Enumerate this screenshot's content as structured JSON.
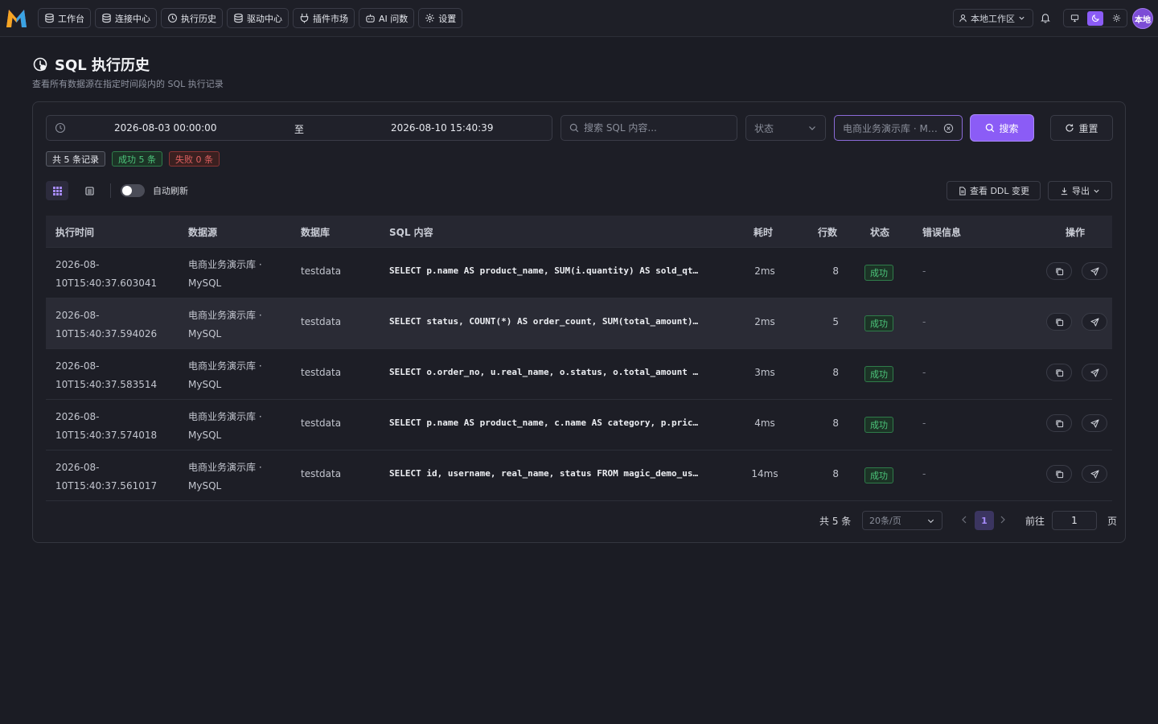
{
  "nav": {
    "items": [
      {
        "label": "工作台",
        "icon": "database-icon"
      },
      {
        "label": "连接中心",
        "icon": "database-icon"
      },
      {
        "label": "执行历史",
        "icon": "history-icon"
      },
      {
        "label": "驱动中心",
        "icon": "database-icon"
      },
      {
        "label": "插件市场",
        "icon": "plug-icon"
      },
      {
        "label": "AI 问数",
        "icon": "robot-icon"
      },
      {
        "label": "设置",
        "icon": "gear-icon"
      }
    ],
    "workspace": "本地工作区",
    "avatar": "本地"
  },
  "page": {
    "title": "SQL 执行历史",
    "subtitle": "查看所有数据源在指定时间段内的 SQL 执行记录"
  },
  "filters": {
    "date_start": "2026-08-03 00:00:00",
    "date_sep": "至",
    "date_end": "2026-08-10 15:40:39",
    "search_placeholder": "搜索 SQL 内容...",
    "status_placeholder": "状态",
    "datasource_value": "电商业务演示库 · MySQL",
    "search_label": "搜索",
    "reset_label": "重置"
  },
  "summary": {
    "total": "共 5 条记录",
    "success": "成功 5 条",
    "failed": "失败 0 条"
  },
  "toolbar": {
    "auto_refresh": "自动刷新",
    "ddl_label": "查看 DDL 变更",
    "export_label": "导出"
  },
  "table": {
    "columns": [
      "执行时间",
      "数据源",
      "数据库",
      "SQL 内容",
      "耗时",
      "行数",
      "状态",
      "错误信息",
      "操作"
    ],
    "rows": [
      {
        "time1": "2026-08-",
        "time2": "10T15:40:37.603041",
        "ds1": "电商业务演示库 ·",
        "ds2": "MySQL",
        "db": "testdata",
        "sql": "SELECT p.name AS product_name, SUM(i.quantity) AS sold_qty FROM magic_demo_order_item i",
        "dur": "2ms",
        "rows": "8",
        "status": "成功",
        "err": "-"
      },
      {
        "time1": "2026-08-",
        "time2": "10T15:40:37.594026",
        "ds1": "电商业务演示库 ·",
        "ds2": "MySQL",
        "db": "testdata",
        "sql": "SELECT status, COUNT(*) AS order_count, SUM(total_amount) AS total FROM magic_demo_order",
        "dur": "2ms",
        "rows": "5",
        "status": "成功",
        "err": "-"
      },
      {
        "time1": "2026-08-",
        "time2": "10T15:40:37.583514",
        "ds1": "电商业务演示库 ·",
        "ds2": "MySQL",
        "db": "testdata",
        "sql": "SELECT o.order_no, u.real_name, o.status, o.total_amount FROM magic_demo_order o",
        "dur": "3ms",
        "rows": "8",
        "status": "成功",
        "err": "-"
      },
      {
        "time1": "2026-08-",
        "time2": "10T15:40:37.574018",
        "ds1": "电商业务演示库 ·",
        "ds2": "MySQL",
        "db": "testdata",
        "sql": "SELECT p.name AS product_name, c.name AS category, p.price FROM magic_demo_product p",
        "dur": "4ms",
        "rows": "8",
        "status": "成功",
        "err": "-"
      },
      {
        "time1": "2026-08-",
        "time2": "10T15:40:37.561017",
        "ds1": "电商业务演示库 ·",
        "ds2": "MySQL",
        "db": "testdata",
        "sql": "SELECT id, username, real_name, status FROM magic_demo_user",
        "dur": "14ms",
        "rows": "8",
        "status": "成功",
        "err": "-"
      }
    ]
  },
  "pagination": {
    "total": "共 5 条",
    "page_size": "20条/页",
    "current": "1",
    "goto_label": "前往",
    "goto_value": "1",
    "unit": "页"
  },
  "colors": {
    "accent": "#8b5cf6",
    "success": "#4cc47a",
    "danger": "#e06060",
    "background": "#1b1c24"
  }
}
